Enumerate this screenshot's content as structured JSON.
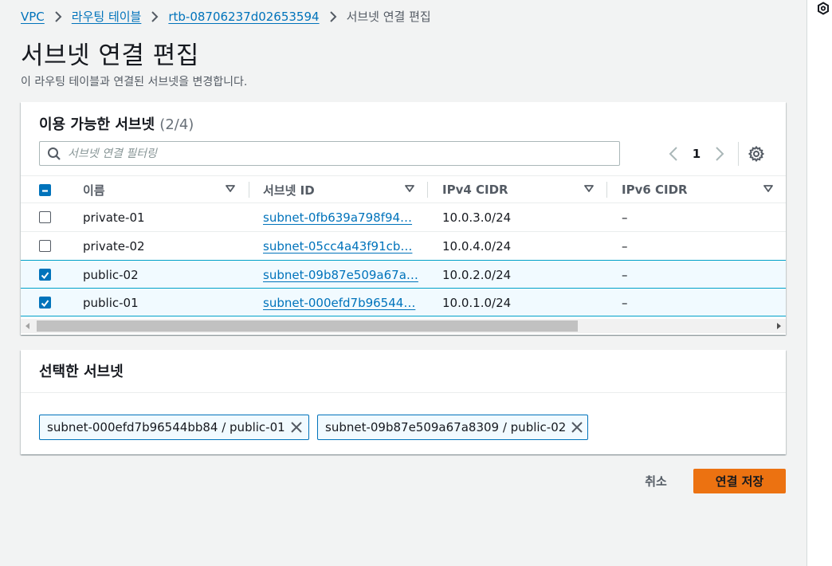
{
  "breadcrumb": {
    "items": [
      {
        "label": "VPC"
      },
      {
        "label": "라우팅 테이블"
      },
      {
        "label": "rtb-08706237d02653594"
      }
    ],
    "current": "서브넷 연결 편집"
  },
  "page": {
    "title": "서브넷 연결 편집",
    "description": "이 라우팅 테이블과 연결된 서브넷을 변경합니다."
  },
  "available_subnets": {
    "title": "이용 가능한 서브넷",
    "count": "(2/4)",
    "filter_placeholder": "서브넷 연결 필터링",
    "current_page": "1",
    "columns": [
      {
        "label": "이름"
      },
      {
        "label": "서브넷 ID"
      },
      {
        "label": "IPv4 CIDR"
      },
      {
        "label": "IPv6 CIDR"
      }
    ],
    "rows": [
      {
        "name": "private-01",
        "subnet_id": "subnet-0fb639a798f94…",
        "ipv4": "10.0.3.0/24",
        "ipv6": "–",
        "selected": false
      },
      {
        "name": "private-02",
        "subnet_id": "subnet-05cc4a43f91cb…",
        "ipv4": "10.0.4.0/24",
        "ipv6": "–",
        "selected": false
      },
      {
        "name": "public-02",
        "subnet_id": "subnet-09b87e509a67a…",
        "ipv4": "10.0.2.0/24",
        "ipv6": "–",
        "selected": true
      },
      {
        "name": "public-01",
        "subnet_id": "subnet-000efd7b96544…",
        "ipv4": "10.0.1.0/24",
        "ipv6": "–",
        "selected": true
      }
    ]
  },
  "selected_subnets": {
    "title": "선택한 서브넷",
    "tokens": [
      {
        "label": "subnet-000efd7b96544bb84 / public-01"
      },
      {
        "label": "subnet-09b87e509a67a8309 / public-02"
      }
    ]
  },
  "actions": {
    "cancel_label": "취소",
    "save_label": "연결 저장"
  },
  "colors": {
    "link": "#0073bb",
    "primary_button": "#ec7211",
    "selected_row_bg": "#f1faff",
    "selected_row_border": "#00a1c9"
  },
  "icons": [
    "chevron-right-icon",
    "search-icon",
    "chevron-left-icon",
    "gear-icon",
    "caret-down-icon",
    "close-icon",
    "checkbox-icon",
    "rail-icon"
  ]
}
